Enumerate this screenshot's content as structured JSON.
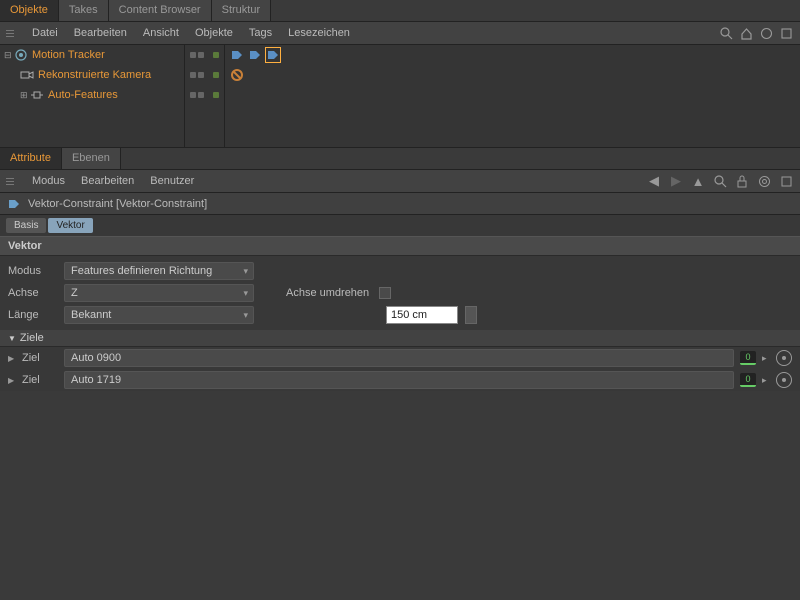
{
  "top_tabs": {
    "objekte": "Objekte",
    "takes": "Takes",
    "content_browser": "Content Browser",
    "struktur": "Struktur"
  },
  "obj_menu": {
    "datei": "Datei",
    "bearbeiten": "Bearbeiten",
    "ansicht": "Ansicht",
    "objekte": "Objekte",
    "tags": "Tags",
    "lesezeichen": "Lesezeichen"
  },
  "tree": {
    "root": "Motion Tracker",
    "child1": "Rekonstruierte Kamera",
    "child2": "Auto-Features"
  },
  "attr_tabs": {
    "attribute": "Attribute",
    "ebenen": "Ebenen"
  },
  "attr_menu": {
    "modus": "Modus",
    "bearbeiten": "Bearbeiten",
    "benutzer": "Benutzer"
  },
  "obj_header": "Vektor-Constraint [Vektor-Constraint]",
  "prop_tabs": {
    "basis": "Basis",
    "vektor": "Vektor"
  },
  "section": "Vektor",
  "props": {
    "modus_label": "Modus",
    "modus_value": "Features definieren Richtung",
    "achse_label": "Achse",
    "achse_value": "Z",
    "achse_umdrehen_label": "Achse umdrehen",
    "laenge_label": "Länge",
    "laenge_value": "Bekannt",
    "length_input": "150 cm"
  },
  "ziele": {
    "header": "Ziele",
    "ziel_label": "Ziel",
    "item1": "Auto 0900",
    "item2": "Auto 1719",
    "badge": "0"
  }
}
